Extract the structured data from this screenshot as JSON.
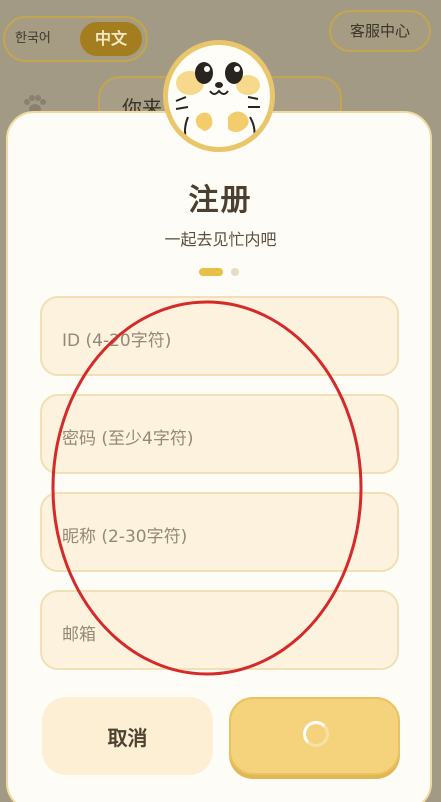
{
  "header": {
    "lang_korean": "한국어",
    "lang_chinese": "中文",
    "customer_service": "客服中心"
  },
  "background": {
    "bubble_text": "你来"
  },
  "modal": {
    "title": "注册",
    "subtitle": "一起去见忙内吧",
    "step": {
      "current": 1,
      "total": 2
    },
    "fields": {
      "id": {
        "placeholder": "ID (4-20字符)"
      },
      "password": {
        "placeholder": "密码 (至少4字符)"
      },
      "nickname": {
        "placeholder": "昵称 (2-30字符)"
      },
      "email": {
        "placeholder": "邮箱"
      }
    },
    "cancel_label": "取消",
    "submit_state": "loading"
  },
  "colors": {
    "accent": "#e9bf4b",
    "field_bg": "#fdf2de",
    "annotation": "#d42a2a"
  }
}
